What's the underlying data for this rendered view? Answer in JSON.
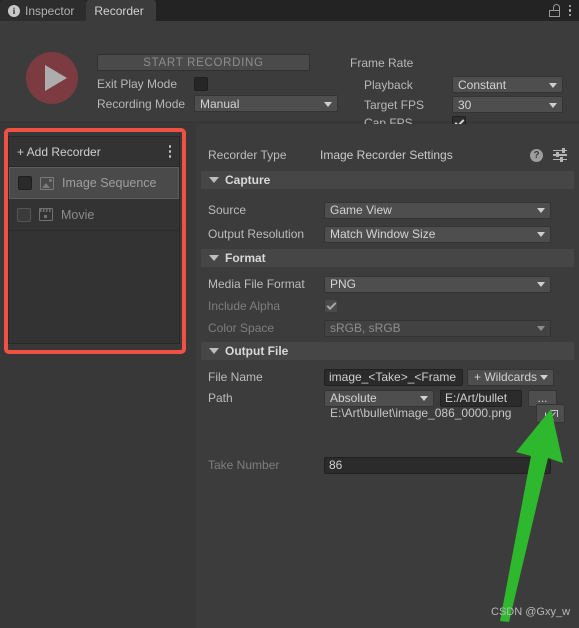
{
  "window": {
    "tabs": [
      {
        "label": "Inspector",
        "icon": "info-icon",
        "active": false
      },
      {
        "label": "Recorder",
        "icon": "",
        "active": true
      }
    ],
    "lock_icon": "lock-icon",
    "menu_icon": "kebab-menu-icon"
  },
  "controls": {
    "play_icon": "play-icon",
    "start_recording_label": "START RECORDING",
    "exit_play_mode_label": "Exit Play Mode",
    "exit_play_mode_checked": false,
    "recording_mode_label": "Recording Mode",
    "recording_mode_value": "Manual"
  },
  "frame_rate": {
    "title": "Frame Rate",
    "playback_label": "Playback",
    "playback_value": "Constant",
    "target_fps_label": "Target FPS",
    "target_fps_value": "30",
    "cap_fps_label": "Cap FPS",
    "cap_fps_checked": true
  },
  "recorder_list": {
    "add_recorder_label": "+ Add Recorder",
    "menu_icon": "kebab-menu-icon",
    "items": [
      {
        "label": "Image Sequence",
        "icon": "image-icon",
        "selected": true,
        "enabled": false
      },
      {
        "label": "Movie",
        "icon": "film-icon",
        "selected": false,
        "enabled": false
      }
    ]
  },
  "settings": {
    "recorder_type_label": "Recorder Type",
    "recorder_type_value": "Image Recorder Settings",
    "help_icon": "help-icon",
    "preset_icon": "preset-settings-icon",
    "capture": {
      "header": "Capture",
      "source_label": "Source",
      "source_value": "Game View",
      "output_resolution_label": "Output Resolution",
      "output_resolution_value": "Match Window Size"
    },
    "format": {
      "header": "Format",
      "media_file_format_label": "Media File Format",
      "media_file_format_value": "PNG",
      "include_alpha_label": "Include Alpha",
      "include_alpha_checked": true,
      "color_space_label": "Color Space",
      "color_space_value": "sRGB, sRGB"
    },
    "output_file": {
      "header": "Output File",
      "file_name_label": "File Name",
      "file_name_value": "image_<Take>_<Frame",
      "wildcards_label": "+ Wildcards",
      "path_label": "Path",
      "path_mode_value": "Absolute",
      "path_value": "E:/Art/bullet",
      "browse_label": "...",
      "path_preview": "E:\\Art\\bullet\\image_086_0000.png",
      "open_external_icon": "open-external-icon",
      "take_number_label": "Take Number",
      "take_number_value": "86"
    }
  },
  "annotations": {
    "highlight_color": "#f05143",
    "arrow_color": "#2eb82e",
    "watermark": "CSDN @Gxy_w"
  }
}
